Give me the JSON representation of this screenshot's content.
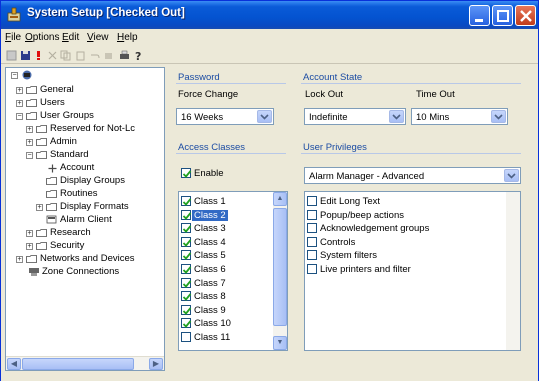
{
  "window": {
    "title": "System Setup [Checked Out]"
  },
  "menu": [
    {
      "label": "File",
      "ul": "F",
      "rest": "ile"
    },
    {
      "label": "Options",
      "ul": "O",
      "rest": "ptions"
    },
    {
      "label": "Edit",
      "ul": "E",
      "rest": "dit"
    },
    {
      "label": "View",
      "ul": "V",
      "rest": "iew"
    },
    {
      "label": "Help",
      "ul": "H",
      "rest": "elp"
    }
  ],
  "tree": {
    "nodes": [
      {
        "label": "General"
      },
      {
        "label": "Users"
      },
      {
        "label": "User Groups"
      },
      {
        "label": "Reserved for Not-Lc"
      },
      {
        "label": "Admin"
      },
      {
        "label": "Standard"
      },
      {
        "label": "Account"
      },
      {
        "label": "Display Groups"
      },
      {
        "label": "Routines"
      },
      {
        "label": "Display Formats"
      },
      {
        "label": "Alarm Client"
      },
      {
        "label": "Research"
      },
      {
        "label": "Security"
      },
      {
        "label": "Networks and Devices"
      },
      {
        "label": "Zone Connections"
      }
    ]
  },
  "password": {
    "section_title": "Password",
    "force_change_label": "Force Change",
    "force_change_value": "16 Weeks"
  },
  "account_state": {
    "section_title": "Account State",
    "lock_out_label": "Lock Out",
    "lock_out_value": "Indefinite",
    "time_out_label": "Time Out",
    "time_out_value": "10 Mins"
  },
  "access_classes": {
    "section_title": "Access Classes",
    "enable_label": "Enable",
    "enable_checked": true,
    "classes": [
      {
        "label": "Class 1",
        "checked": true
      },
      {
        "label": "Class 2",
        "checked": true,
        "selected": true
      },
      {
        "label": "Class 3",
        "checked": true
      },
      {
        "label": "Class 4",
        "checked": true
      },
      {
        "label": "Class 5",
        "checked": true
      },
      {
        "label": "Class 6",
        "checked": true
      },
      {
        "label": "Class 7",
        "checked": true
      },
      {
        "label": "Class 8",
        "checked": true
      },
      {
        "label": "Class 9",
        "checked": true
      },
      {
        "label": "Class 10",
        "checked": true
      },
      {
        "label": "Class 11",
        "checked": false
      }
    ]
  },
  "user_privileges": {
    "section_title": "User Privileges",
    "profile_value": "Alarm Manager - Advanced",
    "items": [
      {
        "label": "Edit Long Text",
        "checked": false
      },
      {
        "label": "Popup/beep actions",
        "checked": false
      },
      {
        "label": "Acknowledgement groups",
        "checked": false
      },
      {
        "label": "Controls",
        "checked": false
      },
      {
        "label": "System filters",
        "checked": false
      },
      {
        "label": "Live printers and filter",
        "checked": false
      }
    ]
  },
  "colors": {
    "accent": "#1c4ca3",
    "selection": "#316ac5",
    "titlebar": "#0453d0"
  }
}
